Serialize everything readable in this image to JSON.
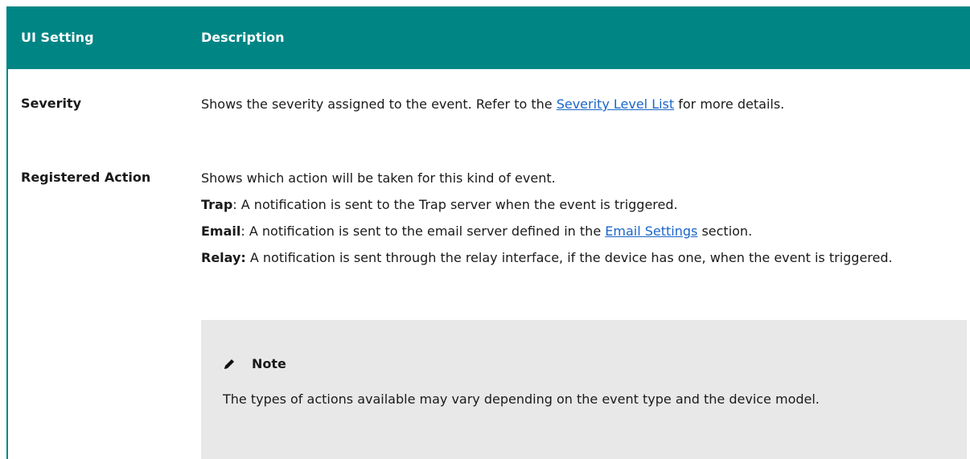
{
  "table": {
    "headers": {
      "setting": "UI Setting",
      "description": "Description"
    },
    "rows": [
      {
        "setting": "Severity",
        "desc_prefix": "Shows the severity assigned to the event. Refer to the ",
        "link": "Severity Level List",
        "desc_suffix": " for more details."
      },
      {
        "setting": "Registered Action",
        "intro": "Shows which action will be taken for this kind of event.",
        "items": [
          {
            "term": "Trap",
            "text": ": A notification is sent to the Trap server when the event is triggered."
          },
          {
            "term": "Email",
            "text_prefix": ": A notification is sent to the email server defined in the ",
            "link": "Email Settings",
            "text_suffix": " section."
          },
          {
            "term": "Relay:",
            "text": " A notification is sent through the relay interface, if the device has one, when the event is triggered."
          }
        ],
        "note": {
          "icon": "pencil-icon",
          "title": "Note",
          "body": "The types of actions available may vary depending on the event type and the device model."
        }
      }
    ]
  },
  "colors": {
    "header_bg": "#008585",
    "link": "#1a66c9",
    "note_bg": "#e8e8e8"
  }
}
